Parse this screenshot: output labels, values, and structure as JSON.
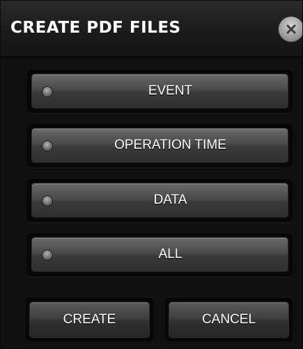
{
  "dialog": {
    "title": "CREATE PDF FILES",
    "close_icon": "close-x-icon"
  },
  "options": [
    {
      "label": "EVENT",
      "indicator": "off"
    },
    {
      "label": "OPERATION TIME",
      "indicator": "off"
    },
    {
      "label": "DATA",
      "indicator": "off"
    },
    {
      "label": "ALL",
      "indicator": "off"
    }
  ],
  "actions": {
    "create_label": "CREATE",
    "cancel_label": "CANCEL"
  },
  "colors": {
    "background": "#101010",
    "button": "#4a4a4a",
    "text": "#ffffff",
    "close_button": "#a0a0a0"
  }
}
